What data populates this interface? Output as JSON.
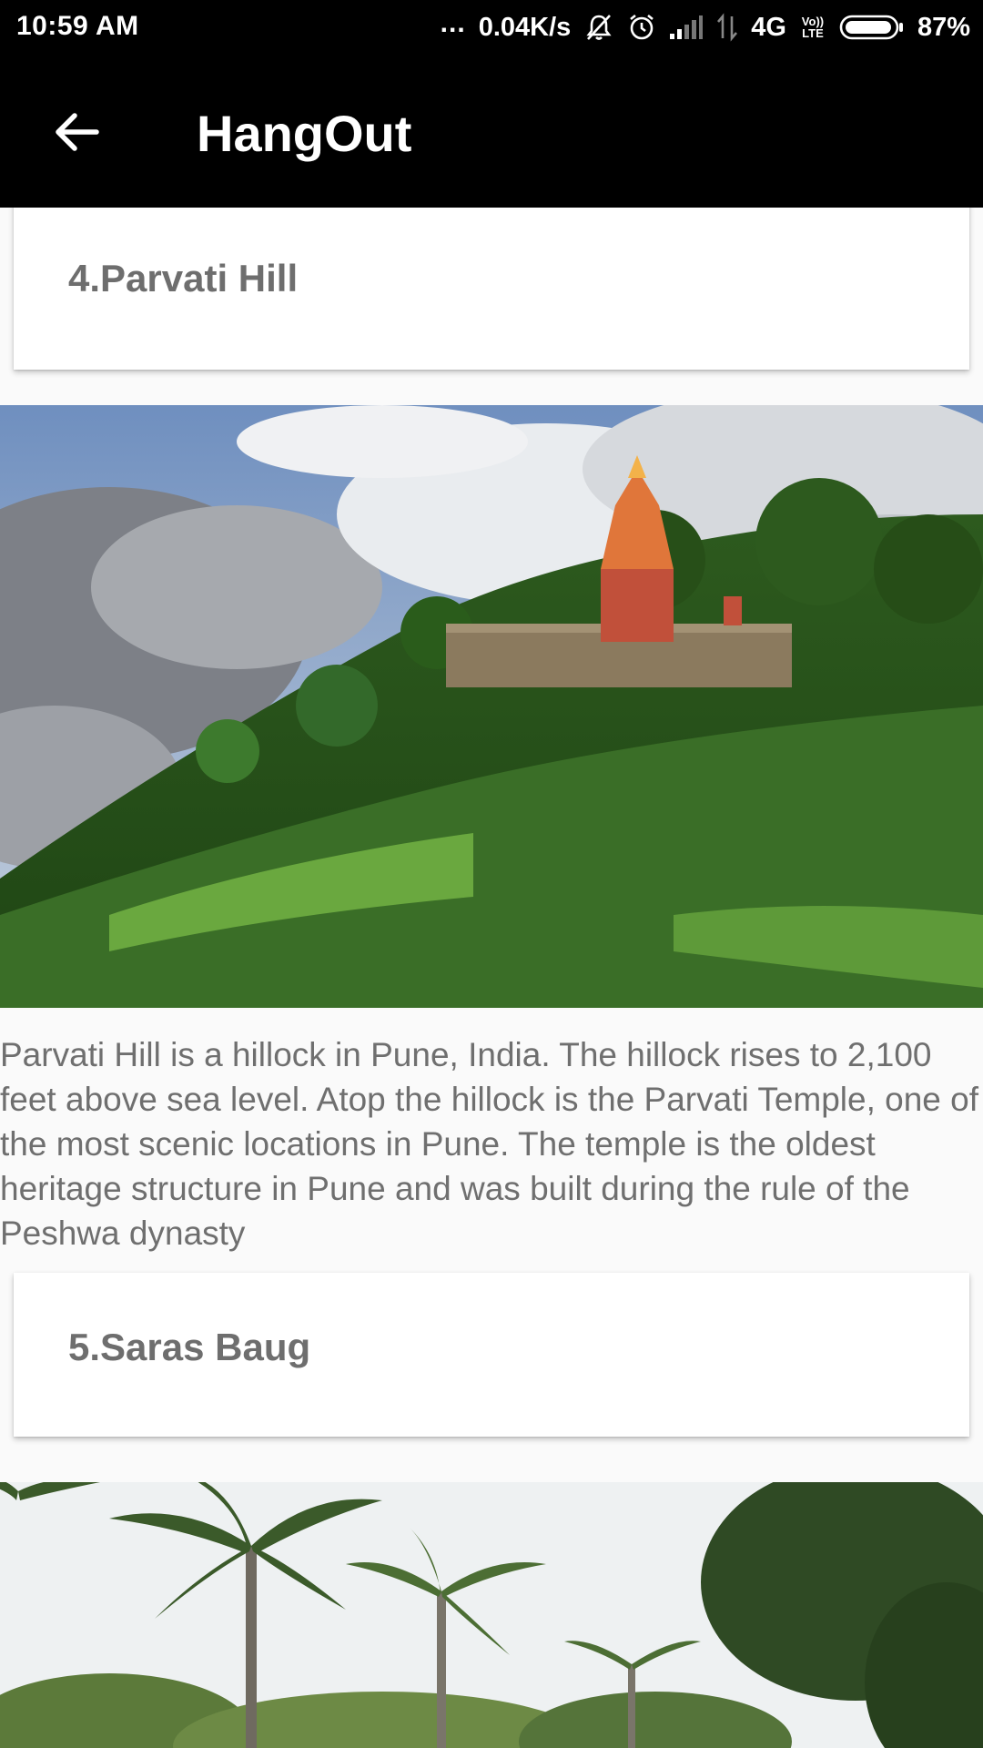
{
  "status_bar": {
    "time": "10:59 AM",
    "dots": "...",
    "network_speed": "0.04K/s",
    "network_type": "4G",
    "volte_top": "Vo))",
    "volte_bottom": "LTE",
    "battery_percent": "87%"
  },
  "app_bar": {
    "title": "HangOut",
    "back_icon": "arrow-left-icon"
  },
  "places": [
    {
      "title": "4.Parvati Hill",
      "description": "Parvati Hill is a hillock in Pune, India. The hillock rises to 2,100 feet above sea level. Atop the hillock is the Parvati Temple, one of the most scenic locations in Pune. The temple is the oldest heritage structure in Pune and was built during the rule of the Peshwa dynasty"
    },
    {
      "title": "5.Saras Baug"
    }
  ],
  "colors": {
    "bar_background": "#000000",
    "page_background": "#fafafa",
    "card_title": "#6e6e6e",
    "body_text": "#6f6f6f"
  }
}
